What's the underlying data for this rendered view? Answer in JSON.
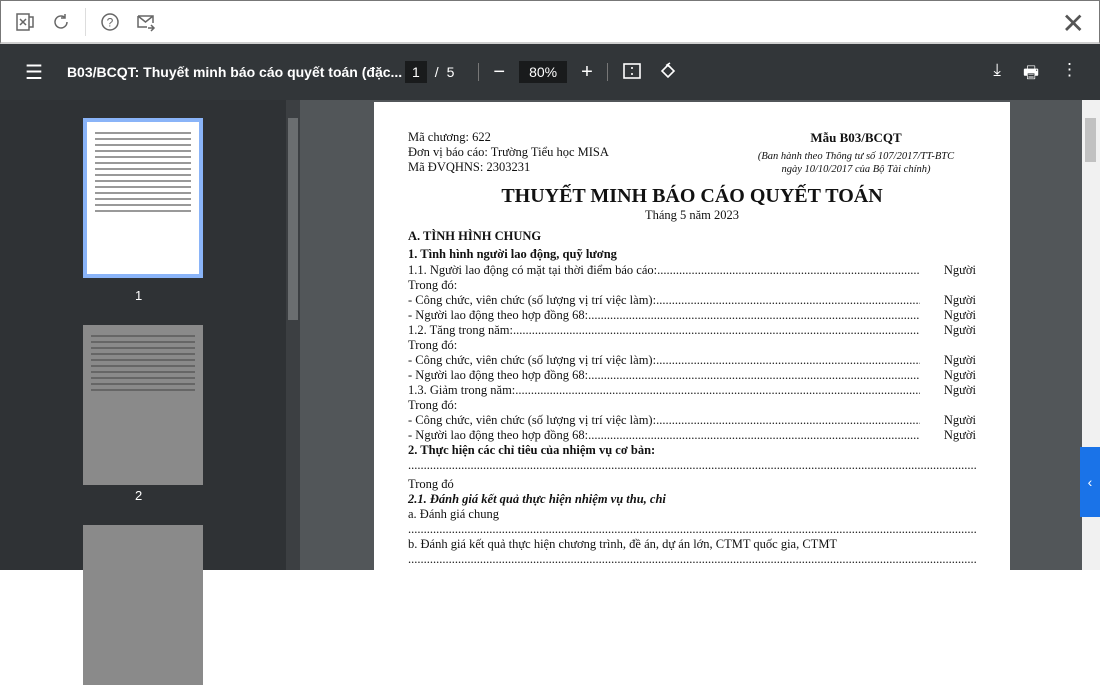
{
  "topbar": {
    "icons": [
      "excel-icon",
      "refresh-icon",
      "help-icon",
      "send-mail-icon",
      "close-icon"
    ]
  },
  "toolbar": {
    "title": "B03/BCQT: Thuyết minh báo cáo quyết toán (đặc...",
    "page_current": "1",
    "page_sep": "/",
    "page_total": "5",
    "zoom": "80%",
    "minus": "−",
    "plus": "+"
  },
  "thumbnails": [
    {
      "label": "1"
    },
    {
      "label": "2"
    }
  ],
  "doc": {
    "ma_chuong": "Mã chương: 622",
    "don_vi": "Đơn vị báo cáo: Trường Tiểu học MISA",
    "ma_dvqhns": "Mã ĐVQHNS: 2303231",
    "mau": "Mẫu B03/BCQT",
    "ban_hanh1": "(Ban hành theo Thông tư số 107/2017/TT-BTC",
    "ban_hanh2": "ngày 10/10/2017 của Bộ Tài chính)",
    "title": "THUYẾT MINH BÁO CÁO QUYẾT TOÁN",
    "month": "Tháng 5 năm 2023",
    "sec_a": "A. TÌNH HÌNH CHUNG",
    "sec_1": "1. Tình hình người lao động, quỹ lương",
    "unit": "Người",
    "rows": [
      {
        "label": "1.1. Người lao động có mặt tại thời điểm báo cáo: ",
        "unit": "Người"
      },
      {
        "label": "Trong đó:"
      },
      {
        "label": "- Công chức, viên chức (số lượng vị trí việc làm): ",
        "unit": "Người"
      },
      {
        "label": "- Người lao động theo hợp đồng 68: ",
        "unit": "Người"
      },
      {
        "label": "1.2. Tăng trong năm: ",
        "unit": "Người"
      },
      {
        "label": "Trong đó:"
      },
      {
        "label": "- Công chức, viên chức (số lượng vị trí việc làm): ",
        "unit": "Người"
      },
      {
        "label": "- Người lao động theo hợp đồng 68: ",
        "unit": "Người"
      },
      {
        "label": "1.3. Giảm trong năm: ",
        "unit": "Người"
      },
      {
        "label": "Trong đó:"
      },
      {
        "label": "- Công chức, viên chức (số lượng vị trí việc làm): ",
        "unit": "Người"
      },
      {
        "label": "- Người lao động theo hợp đồng 68: ",
        "unit": "Người"
      }
    ],
    "sec_2": "2. Thực hiện các chỉ tiêu của nhiệm vụ cơ bản:",
    "trong_do": "Trong đó",
    "sec_21": "2.1. Đánh giá kết quả thực hiện nhiệm vụ thu, chi",
    "a": "a. Đánh giá chung",
    "b": "b. Đánh giá kết quả thực hiện chương trình, đề án, dự án lớn, CTMT quốc gia, CTMT"
  }
}
